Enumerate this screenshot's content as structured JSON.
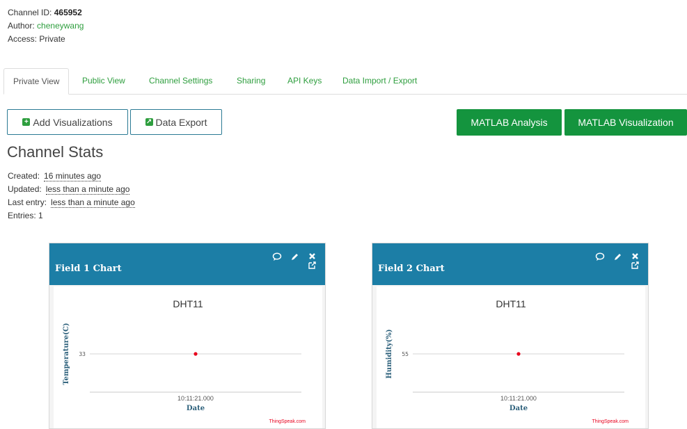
{
  "channel": {
    "id_label": "Channel ID:",
    "id_value": "465952",
    "author_label": "Author:",
    "author_value": "cheneywang",
    "access_label": "Access:",
    "access_value": "Private"
  },
  "tabs": [
    {
      "label": "Private View",
      "active": true
    },
    {
      "label": "Public View"
    },
    {
      "label": "Channel Settings"
    },
    {
      "label": "Sharing"
    },
    {
      "label": "API Keys"
    },
    {
      "label": "Data Import / Export"
    }
  ],
  "buttons": {
    "add_visualizations": "Add Visualizations",
    "data_export": "Data Export",
    "matlab_analysis": "MATLAB Analysis",
    "matlab_visualization": "MATLAB Visualization"
  },
  "stats": {
    "title": "Channel Stats",
    "created_label": "Created:",
    "created_value": "16 minutes ago",
    "updated_label": "Updated:",
    "updated_value": "less than a minute ago",
    "last_entry_label": "Last entry:",
    "last_entry_value": "less than a minute ago",
    "entries_label": "Entries:",
    "entries_value": "1"
  },
  "colors": {
    "accent_green": "#14943e",
    "link_green": "#2e9e3e",
    "panel_header": "#1c7ea6",
    "point_red": "#e8001c"
  },
  "panels": [
    {
      "title": "Field 1 Chart",
      "icons": [
        "comment-icon",
        "pencil-icon",
        "close-icon",
        "external-link-icon"
      ]
    },
    {
      "title": "Field 2 Chart",
      "icons": [
        "comment-icon",
        "pencil-icon",
        "close-icon",
        "external-link-icon"
      ]
    }
  ],
  "chart_data": [
    {
      "type": "line",
      "title": "DHT11",
      "xlabel": "Date",
      "ylabel": "Temperature(C)",
      "x": [
        "10:11:21.000"
      ],
      "series": [
        {
          "values": [
            33
          ]
        }
      ],
      "y_ticks": [
        "33"
      ],
      "credit": "ThingSpeak.com"
    },
    {
      "type": "line",
      "title": "DHT11",
      "xlabel": "Date",
      "ylabel": "Humidity(%)",
      "x": [
        "10:11:21.000"
      ],
      "series": [
        {
          "values": [
            55
          ]
        }
      ],
      "y_ticks": [
        "55"
      ],
      "credit": "ThingSpeak.com"
    }
  ]
}
